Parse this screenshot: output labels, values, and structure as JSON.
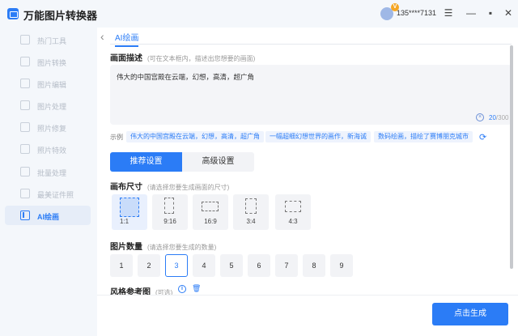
{
  "header": {
    "title": "万能图片转换器",
    "vip_badge": "V",
    "username": "135****7131",
    "menu_glyph": "☰",
    "min_glyph": "—",
    "max_glyph": "▪",
    "close_glyph": "✕"
  },
  "sidebar": {
    "items": [
      {
        "label": "热门工具",
        "icon": "grid-icon"
      },
      {
        "label": "图片转换",
        "icon": "convert-icon"
      },
      {
        "label": "图片编辑",
        "icon": "edit-icon"
      },
      {
        "label": "图片处理",
        "icon": "process-icon"
      },
      {
        "label": "照片修复",
        "icon": "repair-icon"
      },
      {
        "label": "照片特效",
        "icon": "effect-icon"
      },
      {
        "label": "批量处理",
        "icon": "batch-icon"
      },
      {
        "label": "最美证件照",
        "icon": "id-photo-icon"
      },
      {
        "label": "AI绘画",
        "icon": "ai-paint-icon",
        "active": true
      }
    ]
  },
  "main": {
    "back_glyph": "‹",
    "tab_label": "AI绘画",
    "prompt": {
      "title": "画面描述",
      "hint": "(可在文本框内，描述出您想要的画面)",
      "text": "伟大的中国宫殿在云端，幻想，高清，超广角",
      "clear_glyph": "×",
      "count": "20",
      "max": "/300"
    },
    "examples": {
      "label": "示例",
      "chips": [
        "伟大的中国宫殿在云端，幻想，高清，超广角",
        "一幅超细幻想世界的画作，新海诚",
        "数码绘画，描绘了赛博朋克城市"
      ],
      "refresh_glyph": "⟳"
    },
    "settings_tabs": {
      "recommended": "推荐设置",
      "advanced": "高级设置"
    },
    "canvas": {
      "title": "画布尺寸",
      "hint": "(请选择您要生成画面的尺寸)",
      "options": [
        "1:1",
        "9:16",
        "16:9",
        "3:4",
        "4:3"
      ],
      "selected": "1:1"
    },
    "count": {
      "title": "图片数量",
      "hint": "(请选择您要生成的数量)",
      "options": [
        "1",
        "2",
        "3",
        "4",
        "5",
        "6",
        "7",
        "8",
        "9"
      ],
      "selected": "3"
    },
    "style": {
      "title": "风格参考图",
      "hint": "(可选)",
      "info_glyph": "i",
      "trash_glyph": "🗑"
    },
    "generate_label": "点击生成"
  }
}
